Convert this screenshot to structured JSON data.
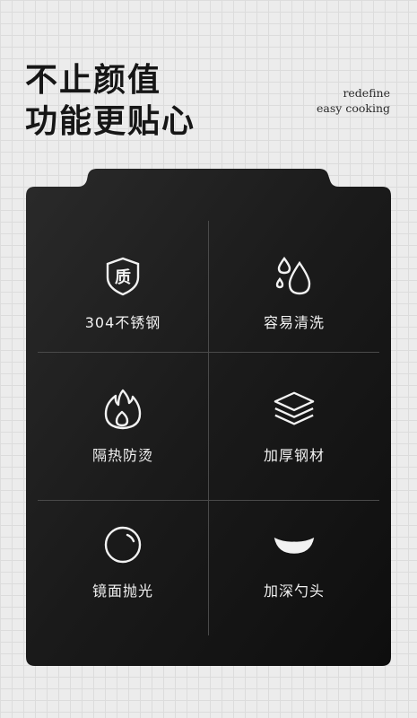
{
  "headline": {
    "line1": "不止颜值",
    "line2": "功能更贴心"
  },
  "tagline": {
    "line1": "redefine",
    "line2": "easy cooking"
  },
  "features": [
    {
      "icon": "quality-shield-icon",
      "icon_text": "质",
      "label": "304不锈钢"
    },
    {
      "icon": "water-drops-icon",
      "label": "容易清洗"
    },
    {
      "icon": "flame-icon",
      "label": "隔热防烫"
    },
    {
      "icon": "layers-icon",
      "label": "加厚钢材"
    },
    {
      "icon": "polished-circle-icon",
      "label": "镜面抛光"
    },
    {
      "icon": "ladle-icon",
      "label": "加深勺头"
    }
  ],
  "colors": {
    "background": "#ececec",
    "card": "#1c1c1c",
    "text_light": "#f2f2f2",
    "headline": "#161616"
  }
}
